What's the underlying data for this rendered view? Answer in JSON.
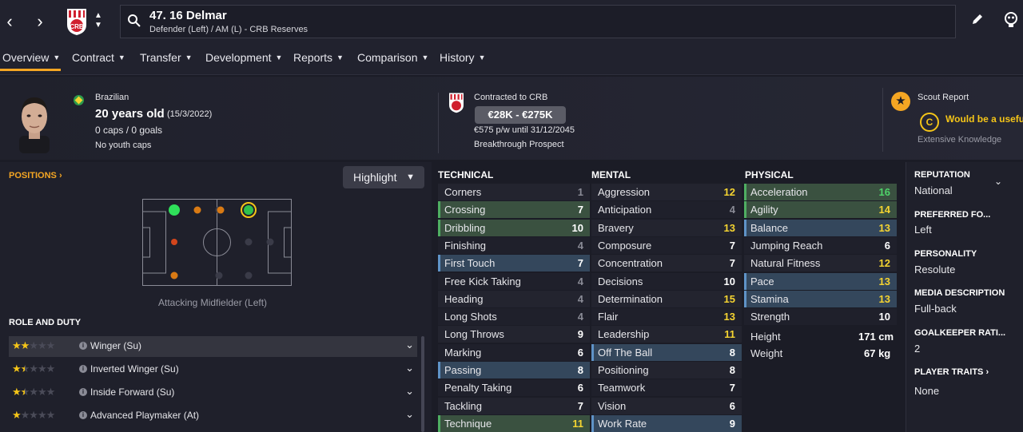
{
  "header": {
    "player_name": "47. 16 Delmar",
    "player_subtitle": "Defender (Left) / AM (L) - CRB Reserves",
    "back_glyph": "‹",
    "forward_glyph": "›"
  },
  "menu": {
    "items": [
      "Overview",
      "Contract",
      "Transfer",
      "Development",
      "Reports",
      "Comparison",
      "History"
    ]
  },
  "profile": {
    "nationality": "Brazilian",
    "age": "20 years old",
    "dob": "(15/3/2022)",
    "caps": "0 caps / 0 goals",
    "youth_caps": "No youth caps"
  },
  "contract": {
    "label": "Contracted to CRB",
    "value_range": "€28K - €275K",
    "wage": "€575 p/w until 31/12/2045",
    "status": "Breakthrough Prospect"
  },
  "scout": {
    "title": "Scout Report",
    "badge": "C",
    "summary": "Would be a usefu",
    "knowledge": "Extensive Knowledge"
  },
  "positions": {
    "title": "POSITIONS ›",
    "highlight_label": "Highlight",
    "position_label": "Attacking Midfielder (Left)"
  },
  "roles": {
    "title": "ROLE AND DUTY",
    "items": [
      {
        "name": "Winger (Su)",
        "stars": 2
      },
      {
        "name": "Inverted Winger (Su)",
        "stars": 1.5
      },
      {
        "name": "Inside Forward (Su)",
        "stars": 1.5
      },
      {
        "name": "Advanced Playmaker (At)",
        "stars": 1
      }
    ]
  },
  "technical": {
    "title": "TECHNICAL",
    "items": [
      {
        "label": "Corners",
        "value": "1",
        "hl": "",
        "color": "#8a8b96"
      },
      {
        "label": "Crossing",
        "value": "7",
        "hl": "green",
        "color": "#ffffff"
      },
      {
        "label": "Dribbling",
        "value": "10",
        "hl": "green",
        "color": "#ffffff"
      },
      {
        "label": "Finishing",
        "value": "4",
        "hl": "",
        "color": "#8a8b96"
      },
      {
        "label": "First Touch",
        "value": "7",
        "hl": "blue",
        "color": "#ffffff"
      },
      {
        "label": "Free Kick Taking",
        "value": "4",
        "hl": "",
        "color": "#8a8b96"
      },
      {
        "label": "Heading",
        "value": "4",
        "hl": "",
        "color": "#8a8b96"
      },
      {
        "label": "Long Shots",
        "value": "4",
        "hl": "",
        "color": "#8a8b96"
      },
      {
        "label": "Long Throws",
        "value": "9",
        "hl": "",
        "color": "#ffffff"
      },
      {
        "label": "Marking",
        "value": "6",
        "hl": "",
        "color": "#ffffff"
      },
      {
        "label": "Passing",
        "value": "8",
        "hl": "blue",
        "color": "#ffffff"
      },
      {
        "label": "Penalty Taking",
        "value": "6",
        "hl": "",
        "color": "#ffffff"
      },
      {
        "label": "Tackling",
        "value": "7",
        "hl": "",
        "color": "#ffffff"
      },
      {
        "label": "Technique",
        "value": "11",
        "hl": "green",
        "color": "#f5d431"
      }
    ]
  },
  "mental": {
    "title": "MENTAL",
    "items": [
      {
        "label": "Aggression",
        "value": "12",
        "hl": "",
        "color": "#f5d431"
      },
      {
        "label": "Anticipation",
        "value": "4",
        "hl": "",
        "color": "#8a8b96"
      },
      {
        "label": "Bravery",
        "value": "13",
        "hl": "",
        "color": "#f5d431"
      },
      {
        "label": "Composure",
        "value": "7",
        "hl": "",
        "color": "#ffffff"
      },
      {
        "label": "Concentration",
        "value": "7",
        "hl": "",
        "color": "#ffffff"
      },
      {
        "label": "Decisions",
        "value": "10",
        "hl": "",
        "color": "#ffffff"
      },
      {
        "label": "Determination",
        "value": "15",
        "hl": "",
        "color": "#f5d431"
      },
      {
        "label": "Flair",
        "value": "13",
        "hl": "",
        "color": "#f5d431"
      },
      {
        "label": "Leadership",
        "value": "11",
        "hl": "",
        "color": "#f5d431"
      },
      {
        "label": "Off The Ball",
        "value": "8",
        "hl": "blue",
        "color": "#ffffff"
      },
      {
        "label": "Positioning",
        "value": "8",
        "hl": "",
        "color": "#ffffff"
      },
      {
        "label": "Teamwork",
        "value": "7",
        "hl": "",
        "color": "#ffffff"
      },
      {
        "label": "Vision",
        "value": "6",
        "hl": "",
        "color": "#ffffff"
      },
      {
        "label": "Work Rate",
        "value": "9",
        "hl": "blue",
        "color": "#ffffff"
      }
    ]
  },
  "physical": {
    "title": "PHYSICAL",
    "items": [
      {
        "label": "Acceleration",
        "value": "16",
        "hl": "green",
        "color": "#4fd46a"
      },
      {
        "label": "Agility",
        "value": "14",
        "hl": "green",
        "color": "#f5d431"
      },
      {
        "label": "Balance",
        "value": "13",
        "hl": "blue",
        "color": "#f5d431"
      },
      {
        "label": "Jumping Reach",
        "value": "6",
        "hl": "",
        "color": "#ffffff"
      },
      {
        "label": "Natural Fitness",
        "value": "12",
        "hl": "",
        "color": "#f5d431"
      },
      {
        "label": "Pace",
        "value": "13",
        "hl": "blue",
        "color": "#f5d431"
      },
      {
        "label": "Stamina",
        "value": "13",
        "hl": "blue",
        "color": "#f5d431"
      },
      {
        "label": "Strength",
        "value": "10",
        "hl": "",
        "color": "#ffffff"
      }
    ],
    "height_label": "Height",
    "height_value": "171 cm",
    "weight_label": "Weight",
    "weight_value": "67 kg"
  },
  "side": {
    "reputation_title": "REPUTATION",
    "reputation_value": "National",
    "foot_title": "PREFERRED FO...",
    "foot_value": "Left",
    "personality_title": "PERSONALITY",
    "personality_value": "Resolute",
    "media_title": "MEDIA DESCRIPTION",
    "media_value": "Full-back",
    "gk_title": "GOALKEEPER RATI...",
    "gk_value": "2",
    "traits_title": "PLAYER TRAITS ›",
    "traits_value": "None"
  },
  "colors": {
    "accent": "#f5a623",
    "green_rating": "#4fd46a",
    "yellow_rating": "#f5d431",
    "club_red": "#d0202e"
  }
}
